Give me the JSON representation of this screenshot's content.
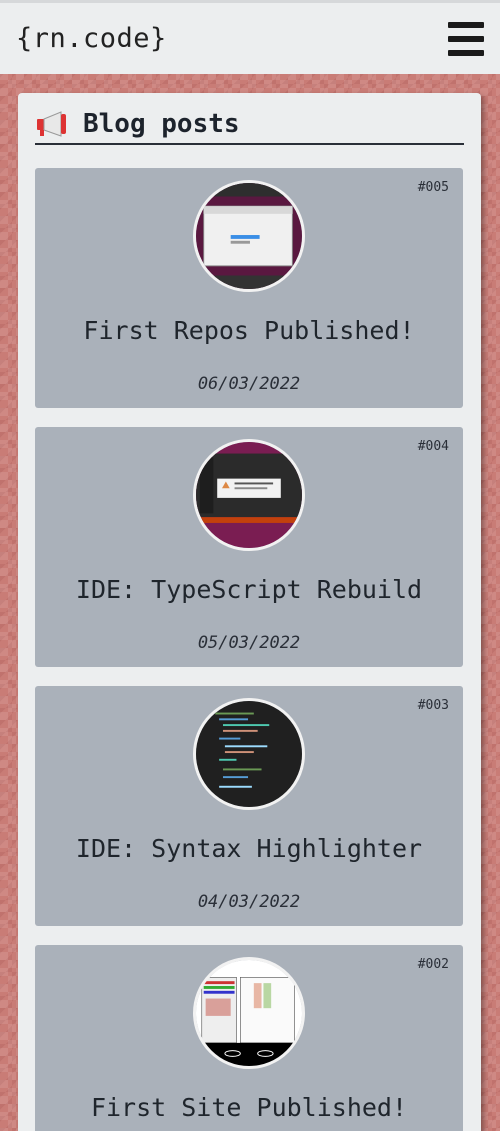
{
  "header": {
    "brand": "{rn.code}",
    "menu_icon": "hamburger-menu-icon"
  },
  "blog": {
    "section_icon": "megaphone-icon",
    "title": "Blog posts",
    "posts": [
      {
        "id": "#005",
        "title": "First Repos Published!",
        "date": "06/03/2022"
      },
      {
        "id": "#004",
        "title": "IDE: TypeScript Rebuild",
        "date": "05/03/2022"
      },
      {
        "id": "#003",
        "title": "IDE: Syntax Highlighter",
        "date": "04/03/2022"
      },
      {
        "id": "#002",
        "title": "First Site Published!",
        "date": ""
      }
    ]
  },
  "colors": {
    "page_background": "#c97c76",
    "card_background": "#aab1ba",
    "panel_background": "#eceeef"
  }
}
